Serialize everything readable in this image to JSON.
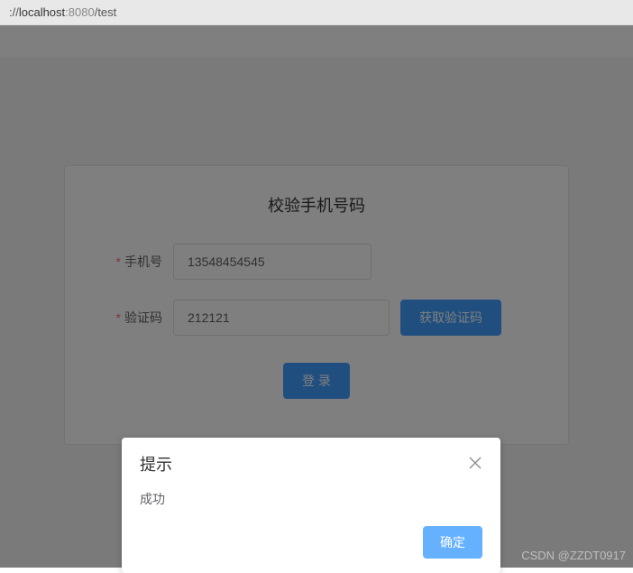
{
  "url": {
    "prefix": "://",
    "host": "localhost",
    "port": ":8080",
    "path": "/test"
  },
  "card": {
    "title": "校验手机号码"
  },
  "form": {
    "phone": {
      "label": "手机号",
      "value": "13548454545"
    },
    "code": {
      "label": "验证码",
      "value": "212121"
    },
    "getcode_label": "获取验证码",
    "submit_label": "登 录"
  },
  "dialog": {
    "title": "提示",
    "message": "成功",
    "confirm_label": "确定"
  },
  "watermark": "CSDN @ZZDT0917"
}
